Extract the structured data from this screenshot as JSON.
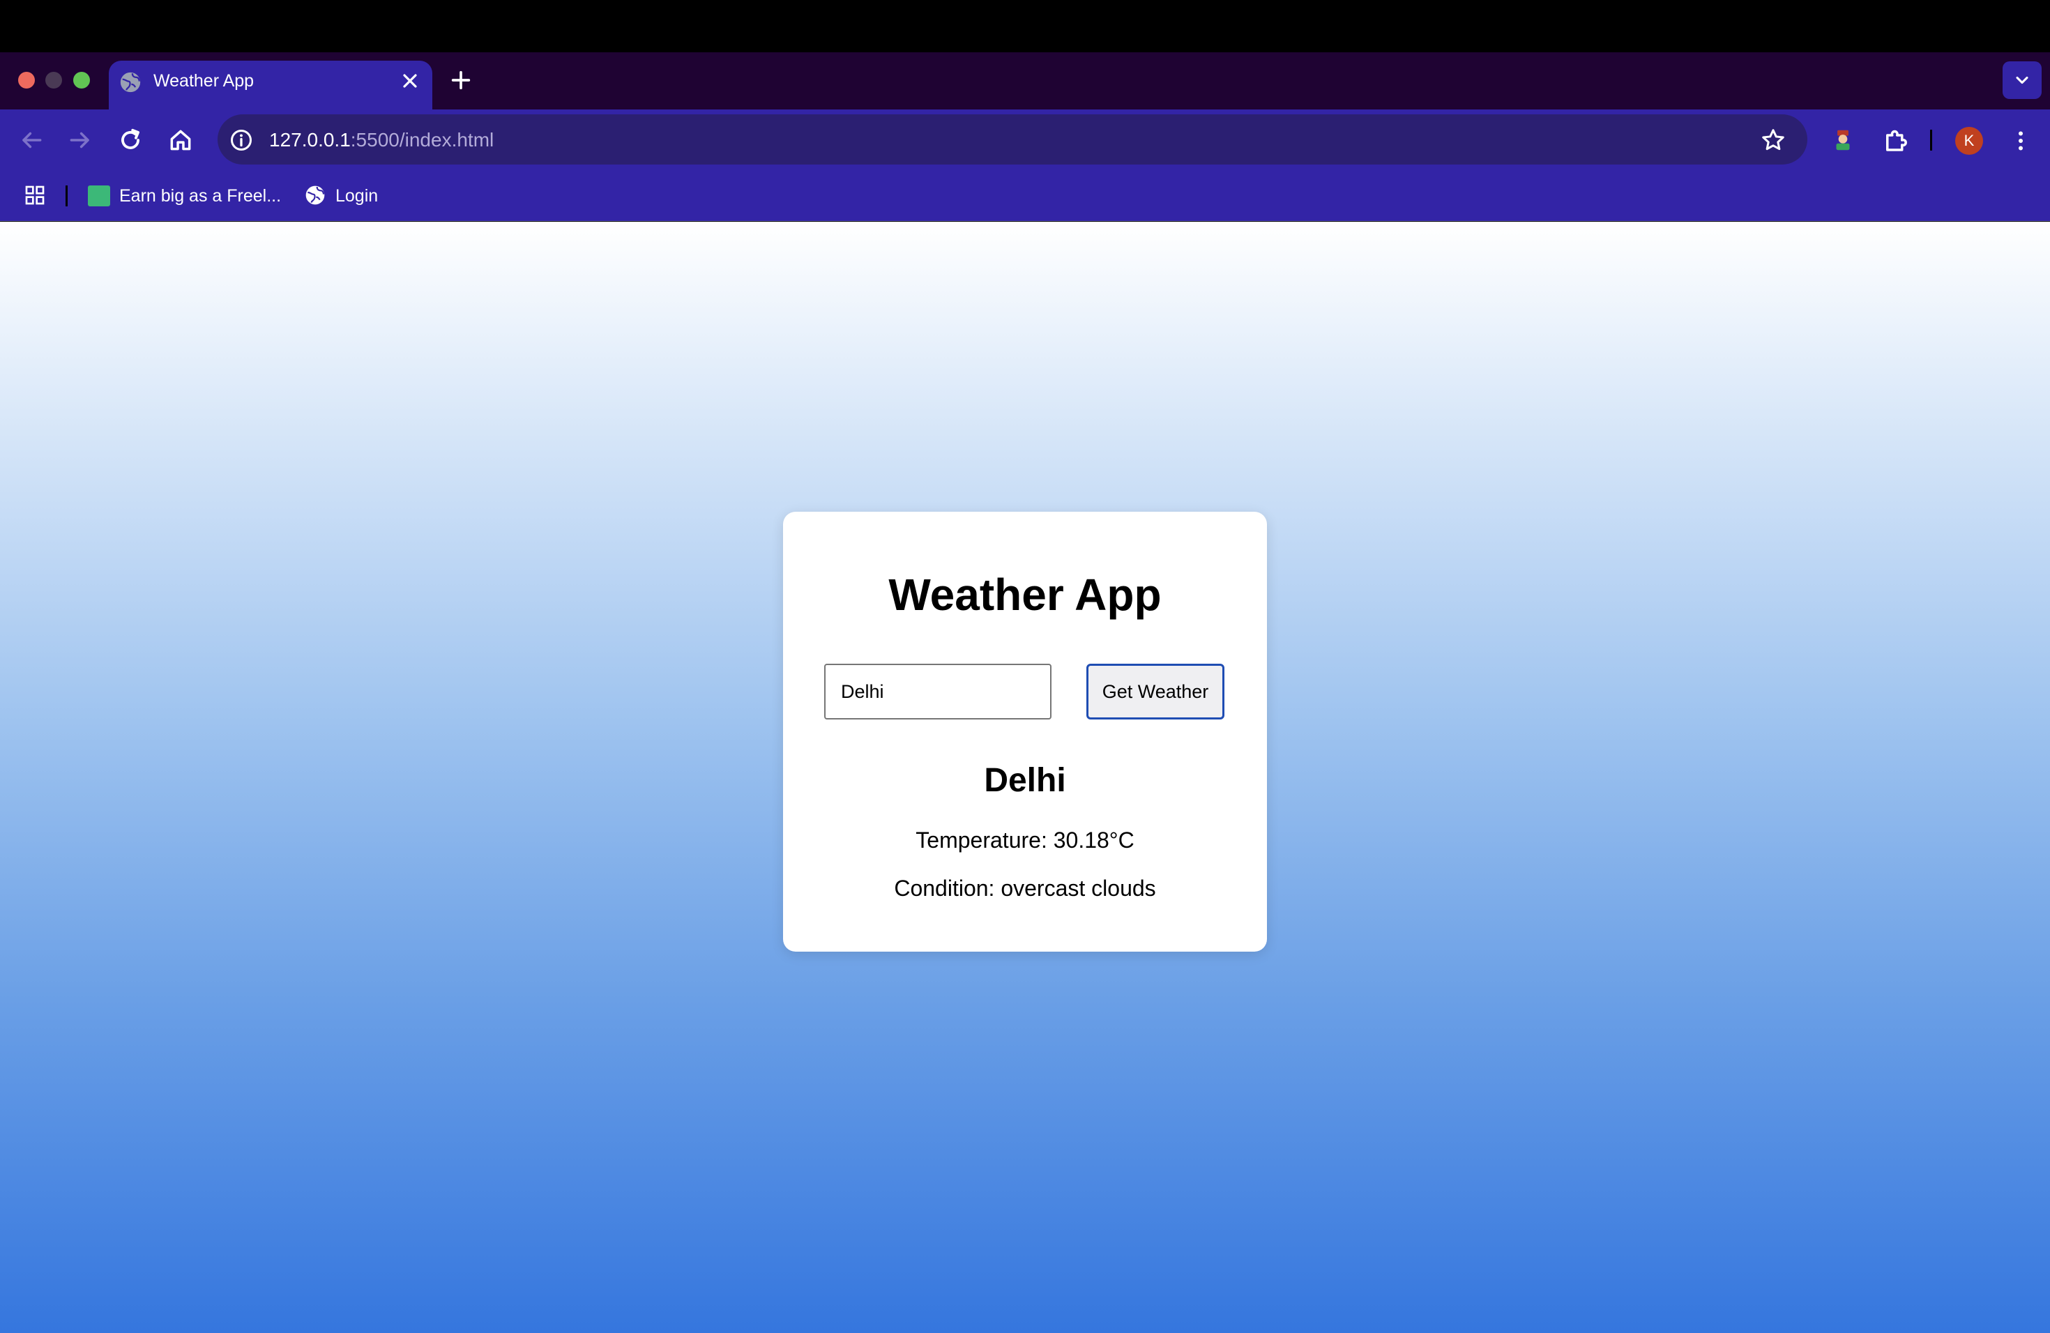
{
  "browser": {
    "tab": {
      "title": "Weather App"
    },
    "address_bar": {
      "host": "127.0.0.1",
      "path": ":5500/index.html"
    },
    "profile_initial": "K",
    "bookmarks": [
      {
        "label": "Earn big as a Freel..."
      },
      {
        "label": "Login"
      }
    ]
  },
  "app": {
    "title": "Weather App",
    "search": {
      "value": "Delhi"
    },
    "button_label": "Get Weather",
    "result": {
      "city": "Delhi",
      "temperature": "Temperature: 30.18°C",
      "condition": "Condition: overcast clouds"
    }
  },
  "colors": {
    "tab_strip": "#1f0333",
    "toolbar": "#3324a6",
    "omnibox": "#2b1f72",
    "button_border": "#1f4db3",
    "gradient_top": "#ffffff",
    "gradient_bottom": "#3576de"
  }
}
